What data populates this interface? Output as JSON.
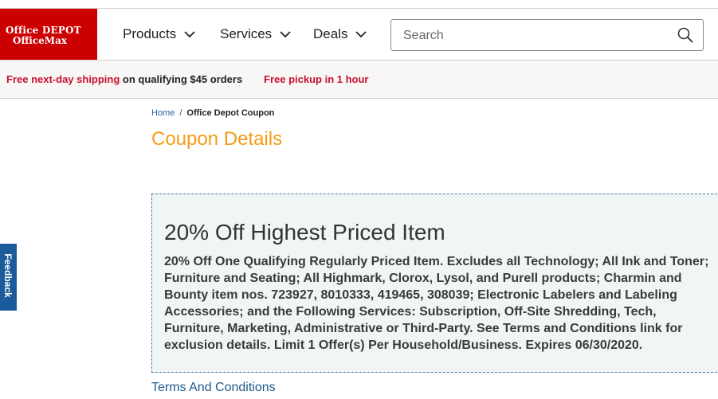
{
  "brand": {
    "line1": "Office DEPOT",
    "line2": "OfficeMax",
    "color": "#cc0000"
  },
  "nav": [
    {
      "label": "Products"
    },
    {
      "label": "Services"
    },
    {
      "label": "Deals"
    }
  ],
  "search": {
    "placeholder": "Search",
    "value": "",
    "icon": "search-icon"
  },
  "promo": {
    "shipping_highlight": "Free next-day shipping",
    "shipping_rest": " on qualifying $45 orders",
    "pickup": "Free pickup in 1 hour"
  },
  "breadcrumb": {
    "home": "Home",
    "separator": "/",
    "current": "Office Depot Coupon"
  },
  "page": {
    "title": "Coupon Details",
    "title_color": "#f49b15"
  },
  "coupon": {
    "headline": "20% Off Highest Priced Item",
    "description": "20% Off One Qualifying Regularly Priced Item. Excludes all Technology; All Ink and Toner; Furniture and Seating; All Highmark, Clorox, Lysol, and Purell products; Charmin and Bounty item nos. 723927, 8010333, 419465, 308039; Electronic Labelers and Labeling Accessories; and the Following Services: Subscription, Off-Site Shredding, Tech, Furniture, Marketing, Administrative or Third-Party. See Terms and Conditions link for exclusion details. Limit 1 Offer(s) Per Household/Business. Expires 06/30/2020."
  },
  "links": {
    "terms": "Terms And Conditions"
  },
  "feedback": {
    "label": "Feedback",
    "color": "#1b5b9b"
  }
}
